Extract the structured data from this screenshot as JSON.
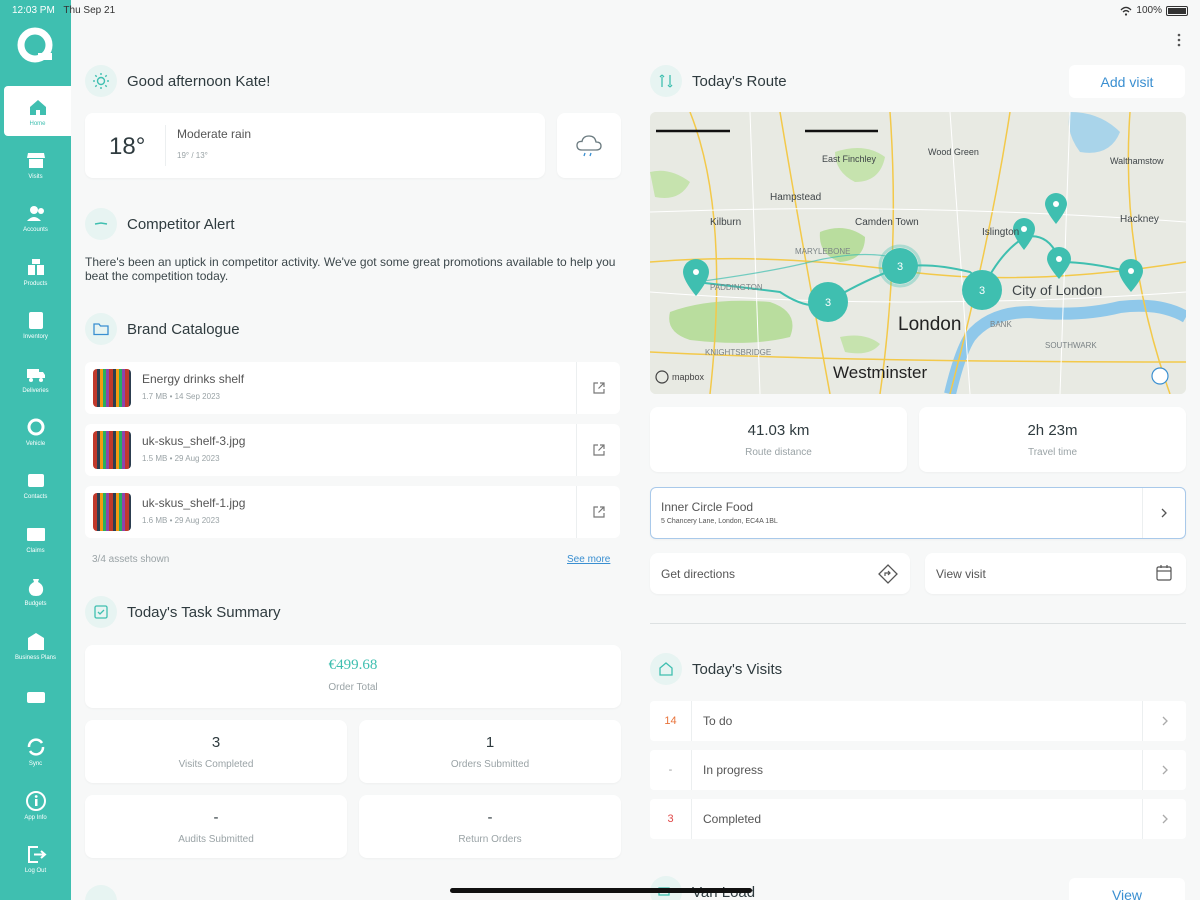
{
  "status_bar": {
    "time": "12:03 PM",
    "date": "Thu Sep 21",
    "battery": "100%"
  },
  "sidebar": {
    "items": [
      {
        "label": "Home",
        "icon": "home-icon"
      },
      {
        "label": "Visits",
        "icon": "store-icon"
      },
      {
        "label": "Accounts",
        "icon": "accounts-icon"
      },
      {
        "label": "Products",
        "icon": "products-icon"
      },
      {
        "label": "Inventory",
        "icon": "inventory-icon"
      },
      {
        "label": "Deliveries",
        "icon": "truck-icon"
      },
      {
        "label": "Vehicle",
        "icon": "vehicle-icon"
      },
      {
        "label": "Contacts",
        "icon": "contacts-icon"
      },
      {
        "label": "Claims",
        "icon": "mail-icon"
      },
      {
        "label": "Budgets",
        "icon": "budget-icon"
      },
      {
        "label": "Business Plans",
        "icon": "business-plans-icon"
      },
      {
        "label": "",
        "icon": "card-icon"
      },
      {
        "label": "Sync",
        "icon": "sync-icon"
      },
      {
        "label": "App Info",
        "icon": "info-icon"
      },
      {
        "label": "Log Out",
        "icon": "logout-icon"
      }
    ]
  },
  "greeting": {
    "title": "Good afternoon Kate!"
  },
  "weather": {
    "temp": "18°",
    "condition": "Moderate rain",
    "range": "19° / 13°"
  },
  "competitor_alert": {
    "title": "Competitor Alert",
    "text": "There's been an uptick in competitor activity. We've got some great promotions available to help you beat the competition today."
  },
  "brand_catalogue": {
    "title": "Brand Catalogue",
    "files": [
      {
        "name": "Energy drinks shelf",
        "meta": "1.7 MB • 14 Sep 2023"
      },
      {
        "name": "uk-skus_shelf-3.jpg",
        "meta": "1.5 MB • 29 Aug 2023"
      },
      {
        "name": "uk-skus_shelf-1.jpg",
        "meta": "1.6 MB • 29 Aug 2023"
      }
    ],
    "count": "3/4 assets shown",
    "see_more": "See more"
  },
  "task_summary": {
    "title": "Today's Task Summary",
    "order_total": "€499.68",
    "order_total_label": "Order Total",
    "visits_completed": "3",
    "visits_completed_label": "Visits Completed",
    "orders_submitted": "1",
    "orders_submitted_label": "Orders Submitted",
    "audits_submitted": "-",
    "audits_submitted_label": "Audits Submitted",
    "return_orders": "-",
    "return_orders_label": "Return Orders"
  },
  "route": {
    "title": "Today's Route",
    "add_visit": "Add visit",
    "map_labels": {
      "east_finchley": "East Finchley",
      "wood_green": "Wood Green",
      "walthamstow": "Walthamstow",
      "hampstead": "Hampstead",
      "camden": "Camden Town",
      "kilburn": "Kilburn",
      "islington": "Islington",
      "hackney": "Hackney",
      "marylebone": "MARYLEBONE",
      "paddington": "PADDINGTON",
      "city": "City of London",
      "london": "London",
      "knightsbridge": "KNIGHTSBRIDGE",
      "westminster": "Westminster",
      "southwark": "SOUTHWARK",
      "bank": "BANK",
      "mapbox": "mapbox",
      "cluster_count": "3"
    },
    "distance": "41.03 km",
    "distance_label": "Route distance",
    "time": "2h 23m",
    "time_label": "Travel time",
    "next_stop_name": "Inner Circle Food",
    "next_stop_address": "5 Chancery Lane, London, EC4A 1BL",
    "get_directions": "Get directions",
    "view_visit": "View visit"
  },
  "todays_visits": {
    "title": "Today's Visits",
    "rows": [
      {
        "count": "14",
        "label": "To do",
        "color": "#e8733a"
      },
      {
        "count": "-",
        "label": "In progress",
        "color": "#999999"
      },
      {
        "count": "3",
        "label": "Completed",
        "color": "#e04848"
      }
    ]
  },
  "van_load": {
    "title": "Van Load",
    "view": "View"
  },
  "colors": {
    "accent": "#3fbfb0",
    "link": "#3a8fd1"
  }
}
